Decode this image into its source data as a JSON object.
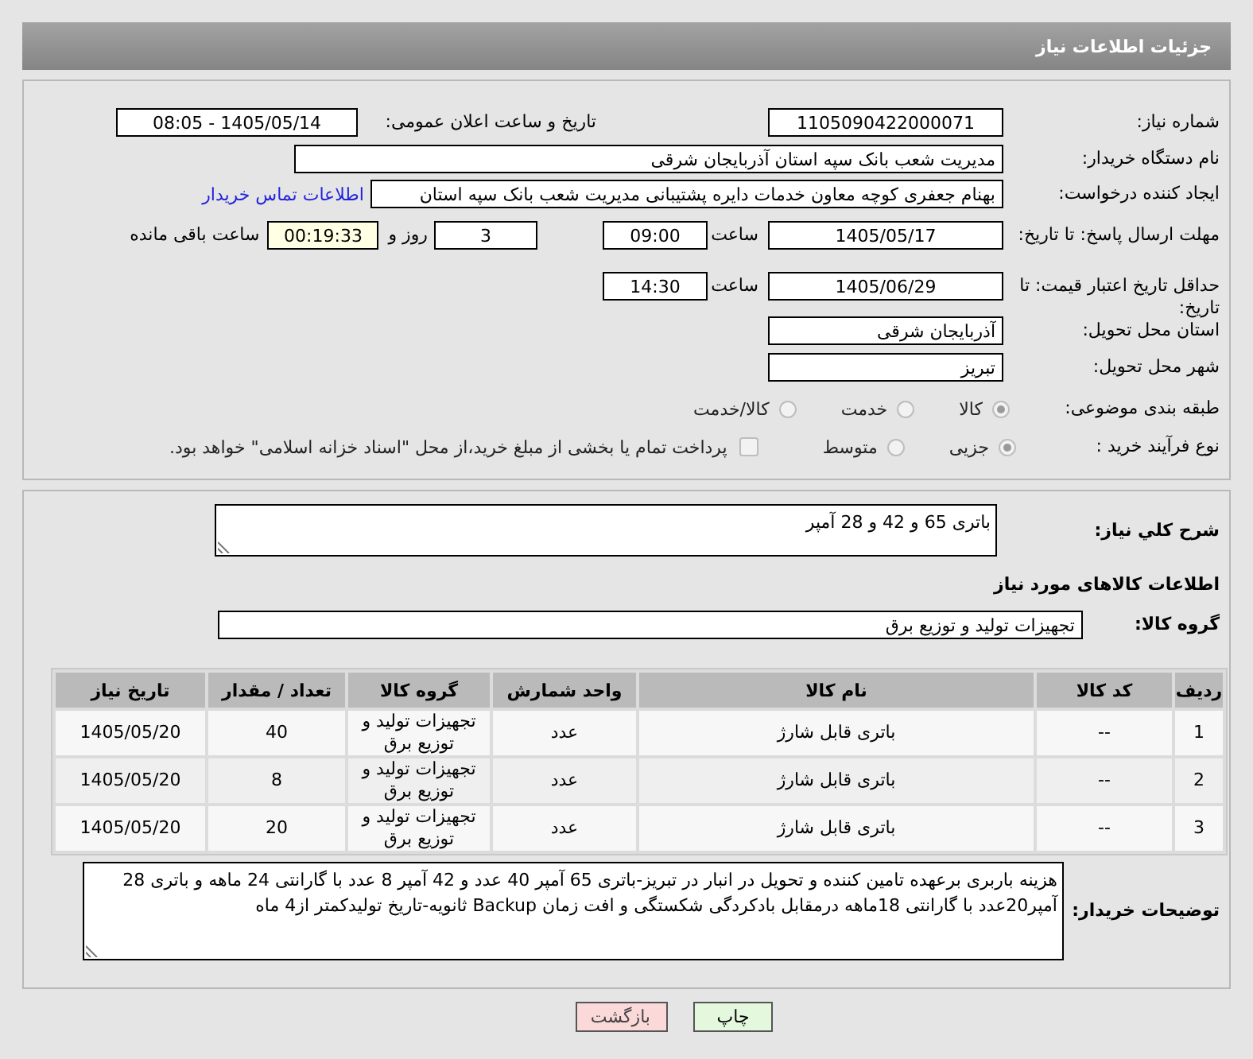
{
  "header": {
    "title": "جزئیات اطلاعات نیاز"
  },
  "need_number": {
    "label": "شماره نیاز:",
    "value": "1105090422000071"
  },
  "announce": {
    "label": "تاریخ و ساعت اعلان عمومی:",
    "value": "1405/05/14 - 08:05"
  },
  "buyer_org": {
    "label": "نام دستگاه خریدار:",
    "value": "مدیریت شعب بانک سپه استان آذربایجان شرقی"
  },
  "requester": {
    "label": "ایجاد کننده درخواست:",
    "value": "بهنام جعفری کوچه معاون خدمات دایره پشتیبانی مدیریت شعب بانک سپه استان",
    "link": "اطلاعات تماس خریدار"
  },
  "deadline": {
    "label": "مهلت ارسال پاسخ: تا تاریخ:",
    "date": "1405/05/17",
    "time_label": "ساعت",
    "time": "09:00",
    "days": "3",
    "days_label": "روز و",
    "remaining": "00:19:33",
    "remaining_label": "ساعت باقی مانده"
  },
  "validity": {
    "label": "حداقل تاریخ اعتبار قیمت: تا تاریخ:",
    "date": "1405/06/29",
    "time_label": "ساعت",
    "time": "14:30"
  },
  "province": {
    "label": "استان محل تحویل:",
    "value": "آذربایجان شرقی"
  },
  "city": {
    "label": "شهر محل تحویل:",
    "value": "تبریز"
  },
  "category": {
    "label": "طبقه بندی موضوعی:",
    "options": [
      {
        "label": "کالا",
        "selected": true
      },
      {
        "label": "خدمت",
        "selected": false
      },
      {
        "label": "کالا/خدمت",
        "selected": false
      }
    ]
  },
  "process": {
    "label": "نوع فرآیند خرید :",
    "options": [
      {
        "label": "جزیی",
        "selected": true
      },
      {
        "label": "متوسط",
        "selected": false
      }
    ],
    "payment": {
      "label": "پرداخت تمام یا بخشی از مبلغ خرید،از محل \"اسناد خزانه اسلامی\" خواهد بود.",
      "checked": false
    }
  },
  "description": {
    "label": "شرح کلي نياز:",
    "value": "باتری 65 و 42 و 28 آمپر"
  },
  "goods_title": "اطلاعات کالاهای مورد نیاز",
  "goods_group": {
    "label": "گروه کالا:",
    "value": "تجهیزات تولید و توزیع برق"
  },
  "table": {
    "columns": [
      "ردیف",
      "کد کالا",
      "نام کالا",
      "واحد شمارش",
      "گروه کالا",
      "تعداد / مقدار",
      "تاریخ نیاز"
    ],
    "rows": [
      [
        "1",
        "--",
        "باتری قابل شارژ",
        "عدد",
        "تجهیزات تولید و توزیع برق",
        "40",
        "1405/05/20"
      ],
      [
        "2",
        "--",
        "باتری قابل شارژ",
        "عدد",
        "تجهیزات تولید و توزیع برق",
        "8",
        "1405/05/20"
      ],
      [
        "3",
        "--",
        "باتری قابل شارژ",
        "عدد",
        "تجهیزات تولید و توزیع برق",
        "20",
        "1405/05/20"
      ]
    ]
  },
  "buyer_notes": {
    "label": "توضیحات خریدار:",
    "value": "هزینه باربری برعهده تامین کننده و تحویل در انبار در تبریز-باتری 65 آمپر 40 عدد و 42 آمپر 8 عدد با گارانتی 24 ماهه و باتری 28 آمپر20عدد با گارانتی 18ماهه درمقابل بادکردگی شکستگی و افت زمان Backup ثانویه-تاریخ تولیدکمتر از4 ماه"
  },
  "buttons": [
    {
      "label": "چاپ",
      "kind": "print"
    },
    {
      "label": "بازگشت",
      "kind": "back"
    }
  ]
}
